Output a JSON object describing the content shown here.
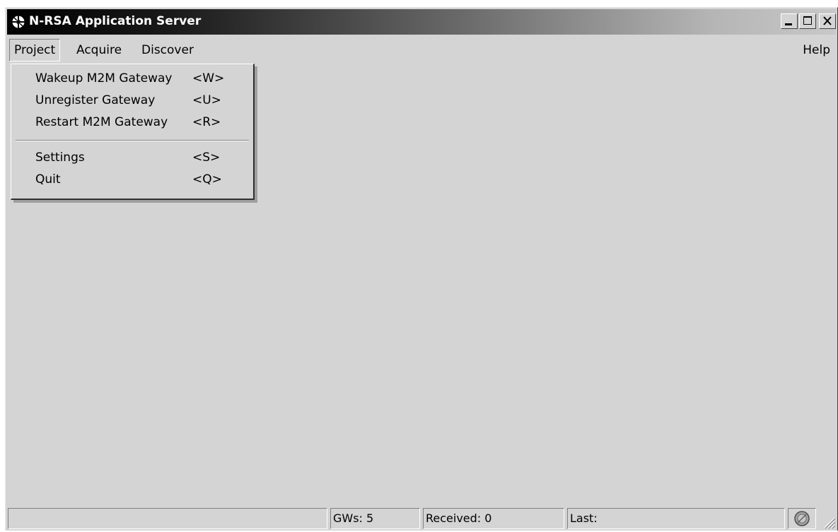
{
  "window": {
    "title": "N-RSA Application Server"
  },
  "menubar": {
    "items": [
      {
        "label": "Project"
      },
      {
        "label": "Acquire"
      },
      {
        "label": "Discover"
      }
    ],
    "help_label": "Help"
  },
  "project_menu": {
    "items": [
      {
        "label": "Wakeup M2M Gateway",
        "shortcut": "<W>"
      },
      {
        "label": "Unregister Gateway",
        "shortcut": "<U>"
      },
      {
        "label": "Restart M2M Gateway",
        "shortcut": "<R>"
      },
      {
        "label": "Settings",
        "shortcut": "<S>"
      },
      {
        "label": "Quit",
        "shortcut": "<Q>"
      }
    ]
  },
  "statusbar": {
    "message": "",
    "gws": "GWs: 5",
    "received": "Received: 0",
    "last": "Last:"
  },
  "icons": {
    "app": "app-icon",
    "minimize": "minimize-icon",
    "maximize": "maximize-icon",
    "close": "close-icon",
    "status": "status-indicator-icon",
    "grip": "resize-grip-icon"
  }
}
